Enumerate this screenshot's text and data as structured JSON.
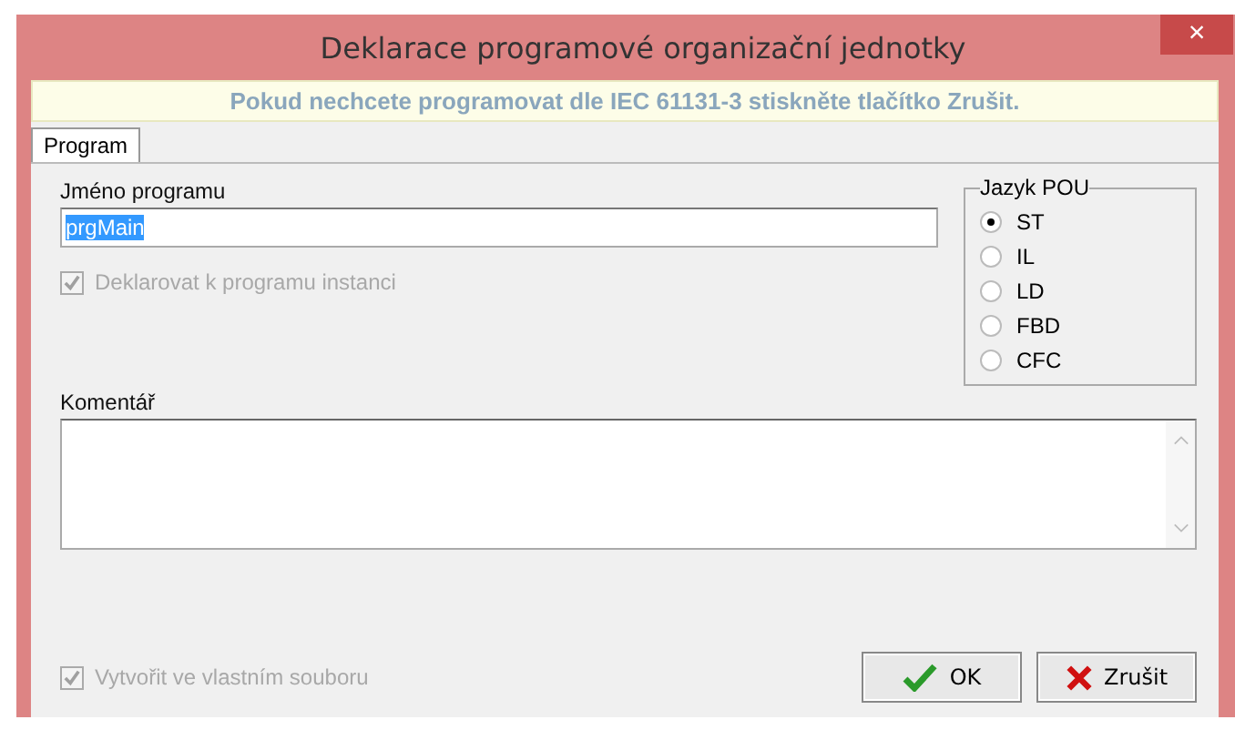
{
  "window": {
    "title": "Deklarace programové organizační jednotky",
    "close": "×"
  },
  "banner": "Pokud nechcete programovat dle IEC 61131-3 stiskněte tlačítko Zrušit.",
  "tabs": [
    {
      "label": "Program",
      "selected": true
    }
  ],
  "name_field": {
    "label": "Jméno programu",
    "value": "prgMain"
  },
  "instance_checkbox": {
    "label": "Deklarovat k programu instanci",
    "checked": true,
    "disabled": true
  },
  "language": {
    "title": "Jazyk POU",
    "options": [
      {
        "label": "ST",
        "selected": true
      },
      {
        "label": "IL",
        "selected": false
      },
      {
        "label": "LD",
        "selected": false
      },
      {
        "label": "FBD",
        "selected": false
      },
      {
        "label": "CFC",
        "selected": false
      }
    ]
  },
  "comment": {
    "label": "Komentář"
  },
  "file_checkbox": {
    "label": "Vytvořit ve vlastním souboru",
    "checked": true,
    "disabled": true
  },
  "buttons": [
    {
      "kind": "ok",
      "label": "OK"
    },
    {
      "kind": "cancel",
      "label": "Zrušit"
    }
  ]
}
